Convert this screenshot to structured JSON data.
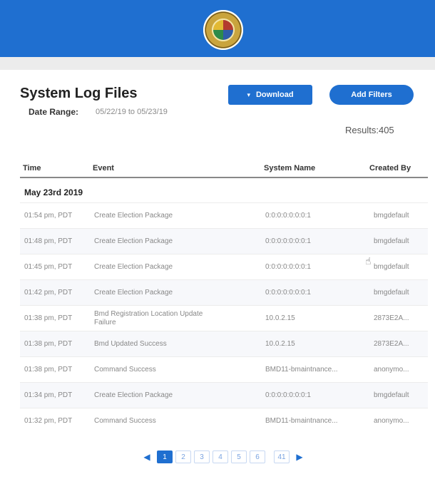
{
  "header": {
    "seal_icon": "county-seal-icon",
    "bg_color": "#1f6fd0"
  },
  "page": {
    "title": "System Log Files",
    "date_range_label": "Date Range:",
    "date_range_value": "05/22/19 to 05/23/19",
    "results": "Results:405"
  },
  "buttons": {
    "download": "Download",
    "add_filters": "Add Filters"
  },
  "table": {
    "headers": {
      "time": "Time",
      "event": "Event",
      "system": "System Name",
      "created": "Created By"
    },
    "group_label": "May 23rd 2019",
    "rows": [
      {
        "time": "01:54 pm, PDT",
        "event": "Create Election Package",
        "system": "0:0:0:0:0:0:0:1",
        "created": "bmgdefault"
      },
      {
        "time": "01:48 pm, PDT",
        "event": "Create Election Package",
        "system": "0:0:0:0:0:0:0:1",
        "created": "bmgdefault"
      },
      {
        "time": "01:45 pm, PDT",
        "event": "Create Election Package",
        "system": "0:0:0:0:0:0:0:1",
        "created": "bmgdefault"
      },
      {
        "time": "01:42 pm, PDT",
        "event": "Create Election Package",
        "system": "0:0:0:0:0:0:0:1",
        "created": "bmgdefault"
      },
      {
        "time": "01:38 pm, PDT",
        "event": "Bmd Registration Location Update Failure",
        "system": "10.0.2.15",
        "created": "2873E2A..."
      },
      {
        "time": "01:38 pm, PDT",
        "event": "Bmd Updated Success",
        "system": "10.0.2.15",
        "created": "2873E2A..."
      },
      {
        "time": "01:38 pm, PDT",
        "event": "Command Success",
        "system": "BMD11-bmaintnance...",
        "created": "anonymo..."
      },
      {
        "time": "01:34 pm, PDT",
        "event": "Create Election Package",
        "system": "0:0:0:0:0:0:0:1",
        "created": "bmgdefault"
      },
      {
        "time": "01:32 pm, PDT",
        "event": "Command Success",
        "system": "BMD11-bmaintnance...",
        "created": "anonymo..."
      }
    ]
  },
  "pagination": {
    "pages": [
      "1",
      "2",
      "3",
      "4",
      "5",
      "6",
      "41"
    ],
    "active": "1"
  }
}
